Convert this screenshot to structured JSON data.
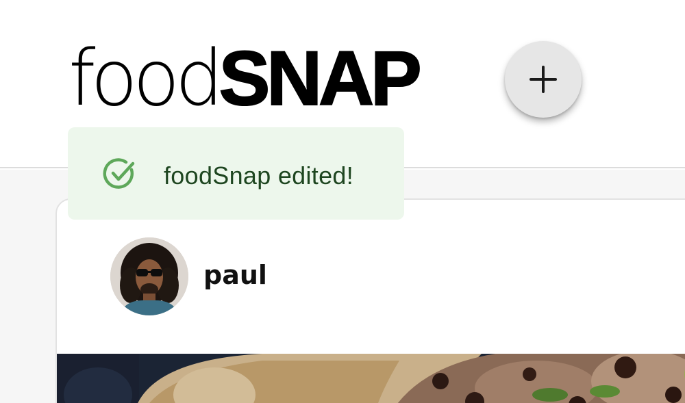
{
  "header": {
    "logo_light": "food",
    "logo_bold": "SNAP",
    "add_button_label": "+"
  },
  "toast": {
    "message": "foodSnap edited!",
    "icon": "check-circle-icon",
    "color": "#edf7ec",
    "text_color": "#1e4620",
    "icon_color": "#5ea85a"
  },
  "post": {
    "username": "paul",
    "avatar": "user-avatar"
  }
}
